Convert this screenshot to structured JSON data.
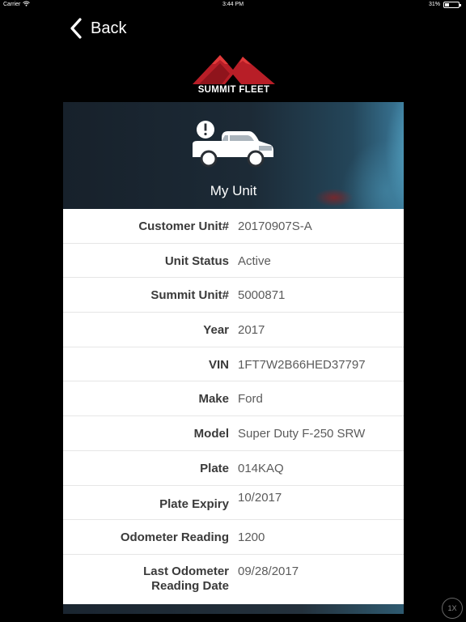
{
  "status_bar": {
    "carrier": "Carrier",
    "time": "3:44 PM",
    "battery": "31%",
    "battery_level": 0.31
  },
  "nav": {
    "back_label": "Back"
  },
  "brand": {
    "name": "SUMMIT FLEET",
    "accent_color": "#c0202a"
  },
  "hero": {
    "title": "My Unit"
  },
  "details": [
    {
      "key": "Customer Unit#",
      "value": "20170907S-A"
    },
    {
      "key": "Unit Status",
      "value": "Active"
    },
    {
      "key": "Summit Unit#",
      "value": "5000871"
    },
    {
      "key": "Year",
      "value": "2017"
    },
    {
      "key": "VIN",
      "value": "1FT7W2B66HED37797"
    },
    {
      "key": "Make",
      "value": "Ford"
    },
    {
      "key": "Model",
      "value": "Super Duty F-250 SRW"
    },
    {
      "key": "Plate",
      "value": "014KAQ"
    },
    {
      "key": "Plate Expiry",
      "value": "10/2017"
    },
    {
      "key": "Odometer Reading",
      "value": "1200"
    },
    {
      "key_line1": "Last Odometer",
      "key_line2": "Reading Date",
      "value": "09/28/2017"
    }
  ],
  "zoom": {
    "label": "1X"
  }
}
